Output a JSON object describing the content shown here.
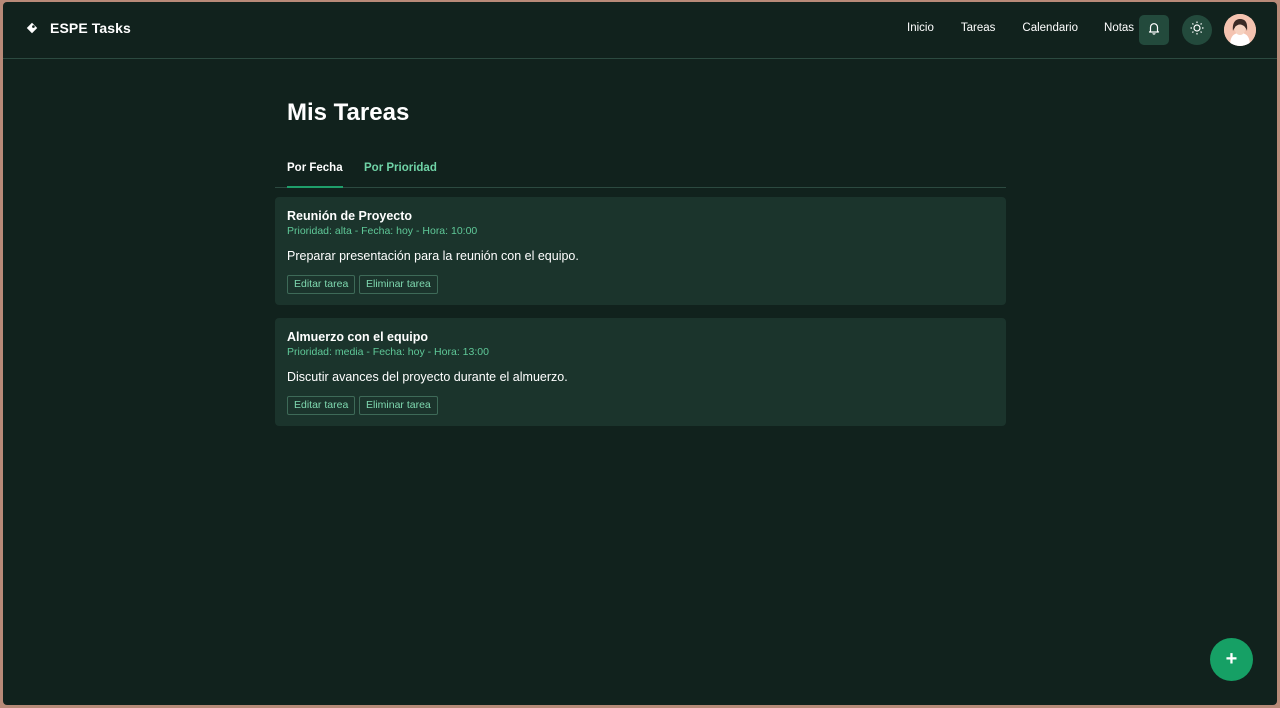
{
  "app": {
    "name": "ESPE Tasks"
  },
  "nav": {
    "items": [
      "Inicio",
      "Tareas",
      "Calendario",
      "Notas"
    ]
  },
  "header": {
    "notification_icon": "bell-icon",
    "theme_icon": "sun-icon",
    "avatar_icon": "user-avatar"
  },
  "main": {
    "title": "Mis Tareas",
    "tabs": [
      {
        "label": "Por Fecha",
        "active": true
      },
      {
        "label": "Por Prioridad",
        "active": false
      }
    ],
    "tasks": [
      {
        "title": "Reunión de Proyecto",
        "meta": "Prioridad: alta - Fecha: hoy - Hora: 10:00",
        "description": "Preparar presentación para la reunión con el equipo.",
        "edit_label": "Editar tarea",
        "delete_label": "Eliminar tarea"
      },
      {
        "title": "Almuerzo con el equipo",
        "meta": "Prioridad: media - Fecha: hoy - Hora: 13:00",
        "description": "Discutir avances del proyecto durante el almuerzo.",
        "edit_label": "Editar tarea",
        "delete_label": "Eliminar tarea"
      }
    ]
  },
  "fab": {
    "label": "+"
  },
  "colors": {
    "background": "#11221d",
    "card": "#1b342c",
    "accent": "#16a065",
    "accent_text": "#6fd3a6"
  }
}
